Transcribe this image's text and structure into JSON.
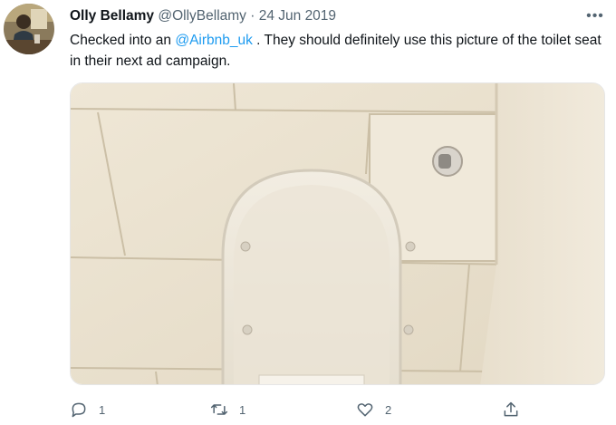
{
  "tweet": {
    "author_name": "Olly Bellamy",
    "author_handle": "@OllyBellamy",
    "separator": "·",
    "date": "24 Jun 2019",
    "more_label": "•••",
    "text_before": "Checked into an ",
    "mention": "@Airbnb_uk",
    "text_after": " . They should definitely use this picture of the toilet seat in their next ad campaign."
  },
  "actions": {
    "reply_count": "1",
    "retweet_count": "1",
    "like_count": "2"
  },
  "icons": [
    "avatar",
    "more-icon",
    "reply-icon",
    "retweet-icon",
    "like-icon",
    "share-icon"
  ],
  "colors": {
    "link": "#1d9bf0",
    "secondary_text": "#536471"
  }
}
